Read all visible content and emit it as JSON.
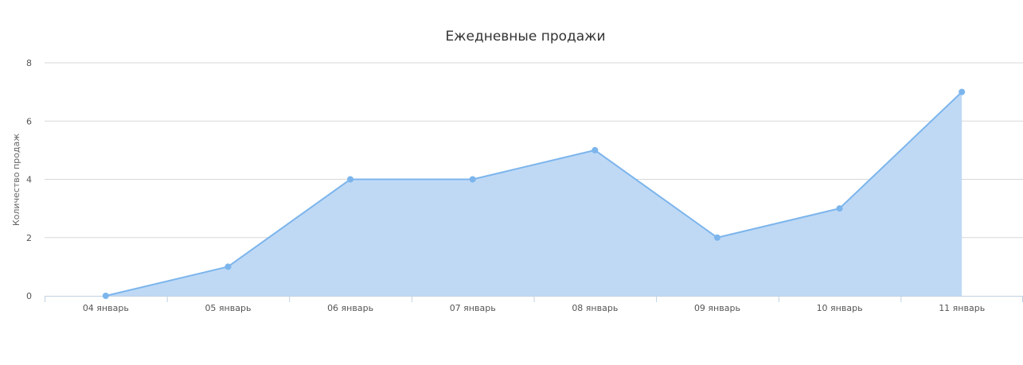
{
  "chart_data": {
    "type": "area",
    "title": "Ежедневные продажи",
    "xlabel": "",
    "ylabel": "Количество продаж",
    "categories": [
      "04 январь",
      "05 январь",
      "06 январь",
      "07 январь",
      "08 январь",
      "09 январь",
      "10 январь",
      "11 январь"
    ],
    "values": [
      0,
      1,
      4,
      4,
      5,
      2,
      3,
      7
    ],
    "ylim": [
      0,
      8
    ],
    "yticks": [
      0,
      2,
      4,
      6,
      8
    ],
    "grid": true,
    "colors": {
      "line": "#7cb5ec",
      "fill": "#bfd9f5",
      "marker": "#7cb5ec"
    }
  }
}
